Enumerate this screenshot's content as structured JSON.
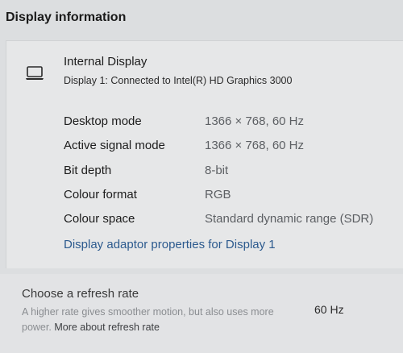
{
  "page": {
    "title": "Display information"
  },
  "display": {
    "icon": "laptop-icon",
    "name": "Internal Display",
    "subtitle": "Display 1: Connected to Intel(R) HD Graphics 3000"
  },
  "info_rows": [
    {
      "label": "Desktop mode",
      "value": "1366 × 768, 60 Hz"
    },
    {
      "label": "Active signal mode",
      "value": "1366 × 768, 60 Hz"
    },
    {
      "label": "Bit depth",
      "value": "8-bit"
    },
    {
      "label": "Colour format",
      "value": "RGB"
    },
    {
      "label": "Colour space",
      "value": "Standard dynamic range (SDR)"
    }
  ],
  "adaptor_link": "Display adaptor properties for Display 1",
  "refresh": {
    "title": "Choose a refresh rate",
    "description": "A higher rate gives smoother motion, but also uses more power.",
    "link": "More about refresh rate",
    "value": "60 Hz"
  },
  "colors": {
    "link": "#2c5a8e",
    "background": "#dcdee0",
    "card": "#e6e7e8"
  }
}
